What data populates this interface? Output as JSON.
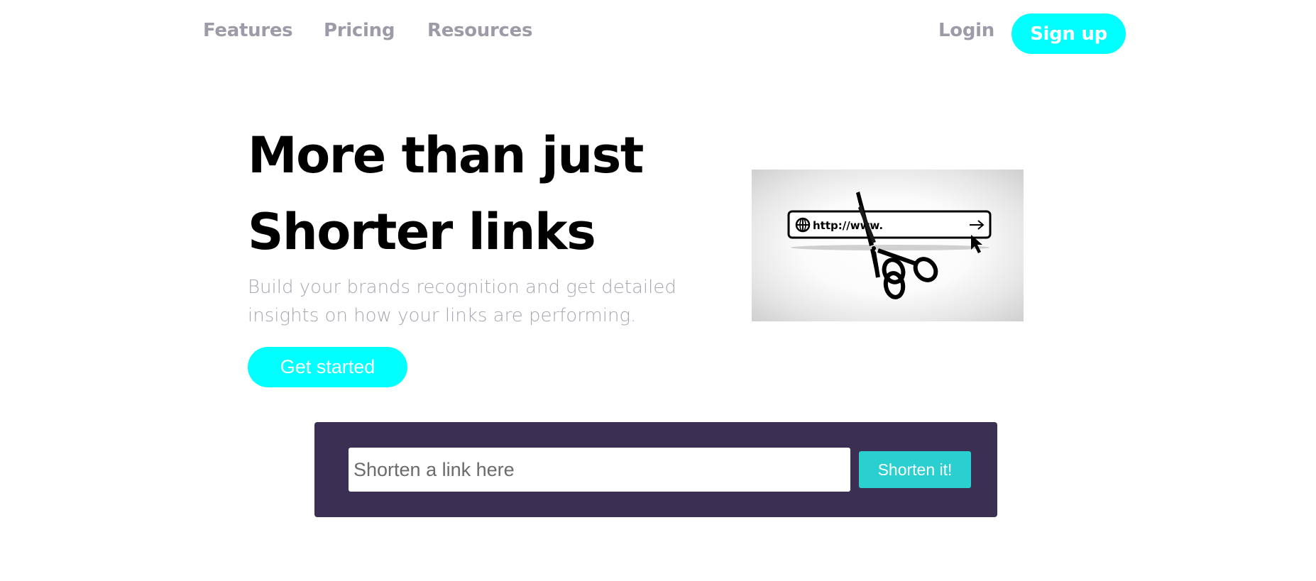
{
  "nav": {
    "features": "Features",
    "pricing": "Pricing",
    "resources": "Resources",
    "login": "Login",
    "signup": "Sign up"
  },
  "hero": {
    "title_line1": "More than just",
    "title_line2": "Shorter links",
    "subtitle_line1": "Build your brands recognition and get detailed",
    "subtitle_line2": "insights on how your links are performing.",
    "cta": "Get started",
    "image": {
      "depicts": "scissors-cutting-url-bar",
      "url_text": "http://www."
    }
  },
  "shorten": {
    "placeholder": "Shorten a link here",
    "value": "",
    "button": "Shorten it!"
  },
  "colors": {
    "accent": "#00ffff",
    "nav_text": "#9e9aa7",
    "subtitle_text": "#a9a6b1",
    "shorten_bg": "#3b3054",
    "shorten_button": "#2acfcf"
  }
}
